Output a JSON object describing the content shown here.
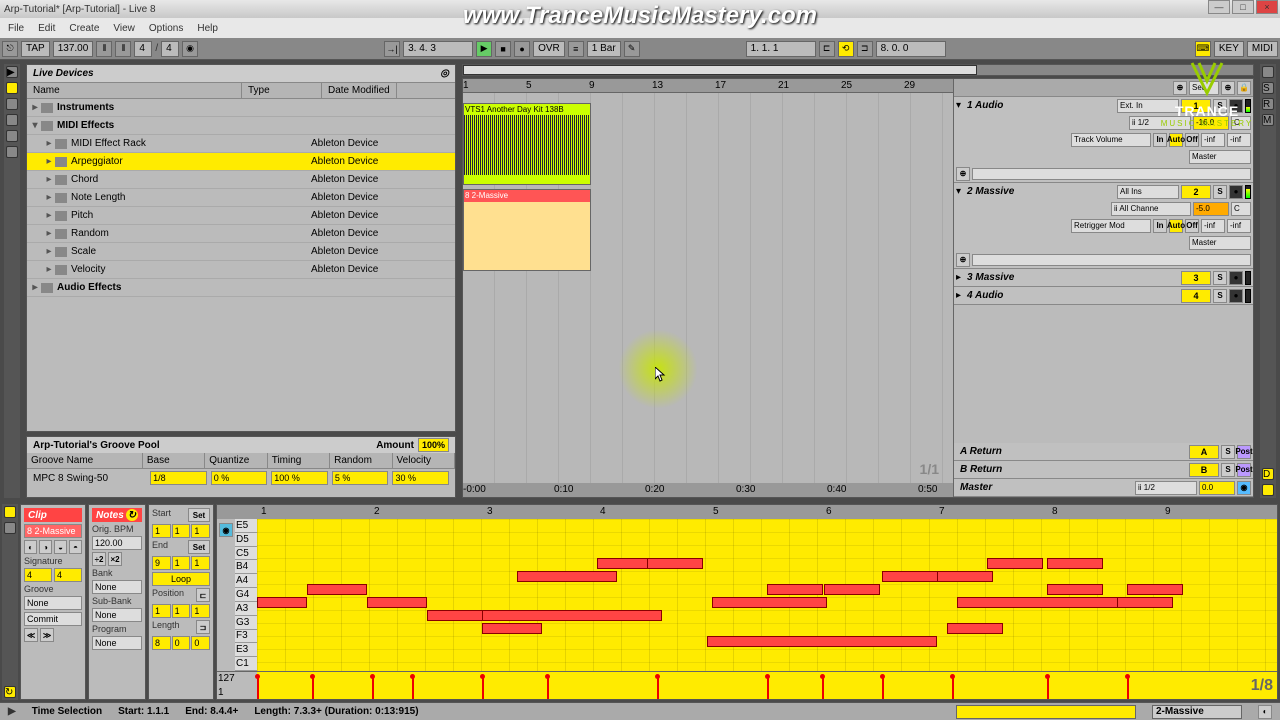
{
  "window": {
    "title": "Arp-Tutorial* [Arp-Tutorial] - Live 8",
    "url": "www.TranceMusicMastery.com"
  },
  "menu": [
    "File",
    "Edit",
    "Create",
    "View",
    "Options",
    "Help"
  ],
  "toolbar": {
    "tap": "TAP",
    "tempo": "137.00",
    "sig1": "4",
    "sig2": "4",
    "pos": "3.  4.  3",
    "ovr": "OVR",
    "quantize": "1 Bar",
    "pos2": "1.  1.  1",
    "pos3": "8.  0.  0",
    "key": "KEY",
    "midi": "MIDI"
  },
  "browser": {
    "title": "Live Devices",
    "cols": [
      "Name",
      "Type",
      "Date Modified"
    ],
    "items": [
      {
        "name": "Instruments",
        "type": "",
        "folder": true,
        "lvl": 0
      },
      {
        "name": "MIDI Effects",
        "type": "",
        "folder": true,
        "lvl": 0,
        "open": true
      },
      {
        "name": "MIDI Effect Rack",
        "type": "Ableton Device",
        "lvl": 1
      },
      {
        "name": "Arpeggiator",
        "type": "Ableton Device",
        "lvl": 1,
        "sel": true
      },
      {
        "name": "Chord",
        "type": "Ableton Device",
        "lvl": 1
      },
      {
        "name": "Note Length",
        "type": "Ableton Device",
        "lvl": 1
      },
      {
        "name": "Pitch",
        "type": "Ableton Device",
        "lvl": 1
      },
      {
        "name": "Random",
        "type": "Ableton Device",
        "lvl": 1
      },
      {
        "name": "Scale",
        "type": "Ableton Device",
        "lvl": 1
      },
      {
        "name": "Velocity",
        "type": "Ableton Device",
        "lvl": 1
      },
      {
        "name": "Audio Effects",
        "type": "",
        "folder": true,
        "lvl": 0
      }
    ]
  },
  "groove": {
    "title": "Arp-Tutorial's Groove Pool",
    "amount_label": "Amount",
    "amount": "100%",
    "cols": [
      "Groove Name",
      "Base",
      "Quantize",
      "Timing",
      "Random",
      "Velocity"
    ],
    "row": {
      "name": "MPC 8 Swing-50",
      "base": "1/8",
      "quantize": "0 %",
      "timing": "100 %",
      "random": "5 %",
      "velocity": "30 %"
    }
  },
  "ruler": [
    1,
    5,
    9,
    13,
    17,
    21,
    25,
    29
  ],
  "timeruler": [
    "-0:00",
    "0:10",
    "0:20",
    "0:30",
    "0:40",
    "0:50"
  ],
  "clips": {
    "audio_name": "VTS1 Another Day Kit 138B",
    "midi_name": "8 2-Massive"
  },
  "tracks": {
    "set": "Set",
    "t1": {
      "name": "1 Audio",
      "io1": "Ext. In",
      "io2": "ii 1/2",
      "io3": "Track Volume",
      "io4": "Master",
      "in": "In",
      "auto": "Auto",
      "off": "Off",
      "vol": "-16.0",
      "pan": "C",
      "send1": "-inf",
      "send2": "-inf",
      "num": "1"
    },
    "t2": {
      "name": "2 Massive",
      "io1": "All Ins",
      "io2": "ii All Channe",
      "io3": "Retrigger Mod",
      "io4": "Master",
      "in": "In",
      "auto": "Auto",
      "off": "Off",
      "vol": "-5.0",
      "pan": "C",
      "send1": "-inf",
      "send2": "-inf",
      "num": "2"
    },
    "t3": {
      "name": "3 Massive",
      "num": "3"
    },
    "t4": {
      "name": "4 Audio",
      "num": "4"
    },
    "ra": {
      "name": "A Return",
      "num": "A"
    },
    "rb": {
      "name": "B Return",
      "num": "B"
    },
    "m": {
      "name": "Master",
      "out": "ii 1/2",
      "vol": "0.0"
    },
    "sc": "1/1"
  },
  "clip": {
    "hdr1": "Clip",
    "name": "8 2-Massive",
    "sig_lbl": "Signature",
    "sig1": "4",
    "sig2": "4",
    "grv_lbl": "Groove",
    "grv": "None",
    "commit": "Commit",
    "hdr2": "Notes",
    "bpm_lbl": "Orig. BPM",
    "bpm": "120.00",
    "x2": "×2",
    "d2": "÷2",
    "bank_lbl": "Bank",
    "bank": "None",
    "sub_lbl": "Sub-Bank",
    "sub": "None",
    "prg_lbl": "Program",
    "prg": "None",
    "start_lbl": "Start",
    "start_set": "Set",
    "start1": "1",
    "start2": "1",
    "start3": "1",
    "end_lbl": "End",
    "end_set": "Set",
    "end1": "9",
    "end2": "1",
    "end3": "1",
    "loop": "Loop",
    "pos_lbl": "Position",
    "pos1": "1",
    "pos2": "1",
    "pos3": "1",
    "len_lbl": "Length",
    "len1": "8",
    "len2": "0",
    "len3": "0",
    "fold": "Fold",
    "ruler": [
      1,
      2,
      3,
      4,
      5,
      6,
      7,
      8,
      9
    ],
    "keys": [
      "E5",
      "D5",
      "C5",
      "B4",
      "A4",
      "G4",
      "A3",
      "G3",
      "F3",
      "E3",
      "C1"
    ],
    "vel_max": "127",
    "vel_min": "1",
    "pages": "1/8"
  },
  "status": {
    "label": "Time Selection",
    "start": "Start: 1.1.1",
    "end": "End: 8.4.4+",
    "len": "Length: 7.3.3+  (Duration: 0:13:915)",
    "device": "2-Massive"
  },
  "logo": {
    "brand": "TRANCE",
    "sub": "MUSIC MASTERY"
  }
}
